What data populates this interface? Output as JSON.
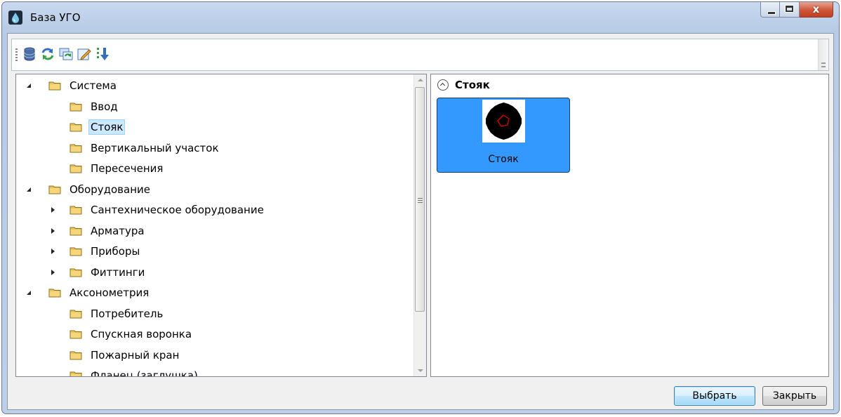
{
  "window": {
    "title": "База УГО",
    "close_glyph": "x"
  },
  "toolbar": {
    "buttons": [
      {
        "icon": "database-icon"
      },
      {
        "icon": "refresh-icon"
      },
      {
        "icon": "sync-icon"
      },
      {
        "icon": "edit-icon"
      },
      {
        "icon": "sort-icon"
      }
    ]
  },
  "tree": {
    "items": [
      {
        "label": "Система",
        "level": 0,
        "expander": "expanded"
      },
      {
        "label": "Ввод",
        "level": 1,
        "expander": "none"
      },
      {
        "label": "Стояк",
        "level": 1,
        "expander": "none",
        "selected": true
      },
      {
        "label": "Вертикальный участок",
        "level": 1,
        "expander": "none"
      },
      {
        "label": "Пересечения",
        "level": 1,
        "expander": "none"
      },
      {
        "label": "Оборудование",
        "level": 0,
        "expander": "expanded"
      },
      {
        "label": "Сантехническое оборудование",
        "level": 1,
        "expander": "collapsed"
      },
      {
        "label": "Арматура",
        "level": 1,
        "expander": "collapsed"
      },
      {
        "label": "Приборы",
        "level": 1,
        "expander": "collapsed"
      },
      {
        "label": "Фиттинги",
        "level": 1,
        "expander": "collapsed"
      },
      {
        "label": "Аксонометрия",
        "level": 0,
        "expander": "expanded"
      },
      {
        "label": "Потребитель",
        "level": 1,
        "expander": "none"
      },
      {
        "label": "Спускная воронка",
        "level": 1,
        "expander": "none"
      },
      {
        "label": "Пожарный кран",
        "level": 1,
        "expander": "none"
      },
      {
        "label": "Фланец (заглушка)",
        "level": 1,
        "expander": "none"
      }
    ]
  },
  "group": {
    "title": "Стояк",
    "items": [
      {
        "label": "Стояк",
        "selected": true
      }
    ]
  },
  "buttons": {
    "select": "Выбрать",
    "close": "Закрыть"
  },
  "colors": {
    "selection": "#3399ff",
    "tree_selection": "#cce8ff",
    "folder": "#f5d67a"
  }
}
